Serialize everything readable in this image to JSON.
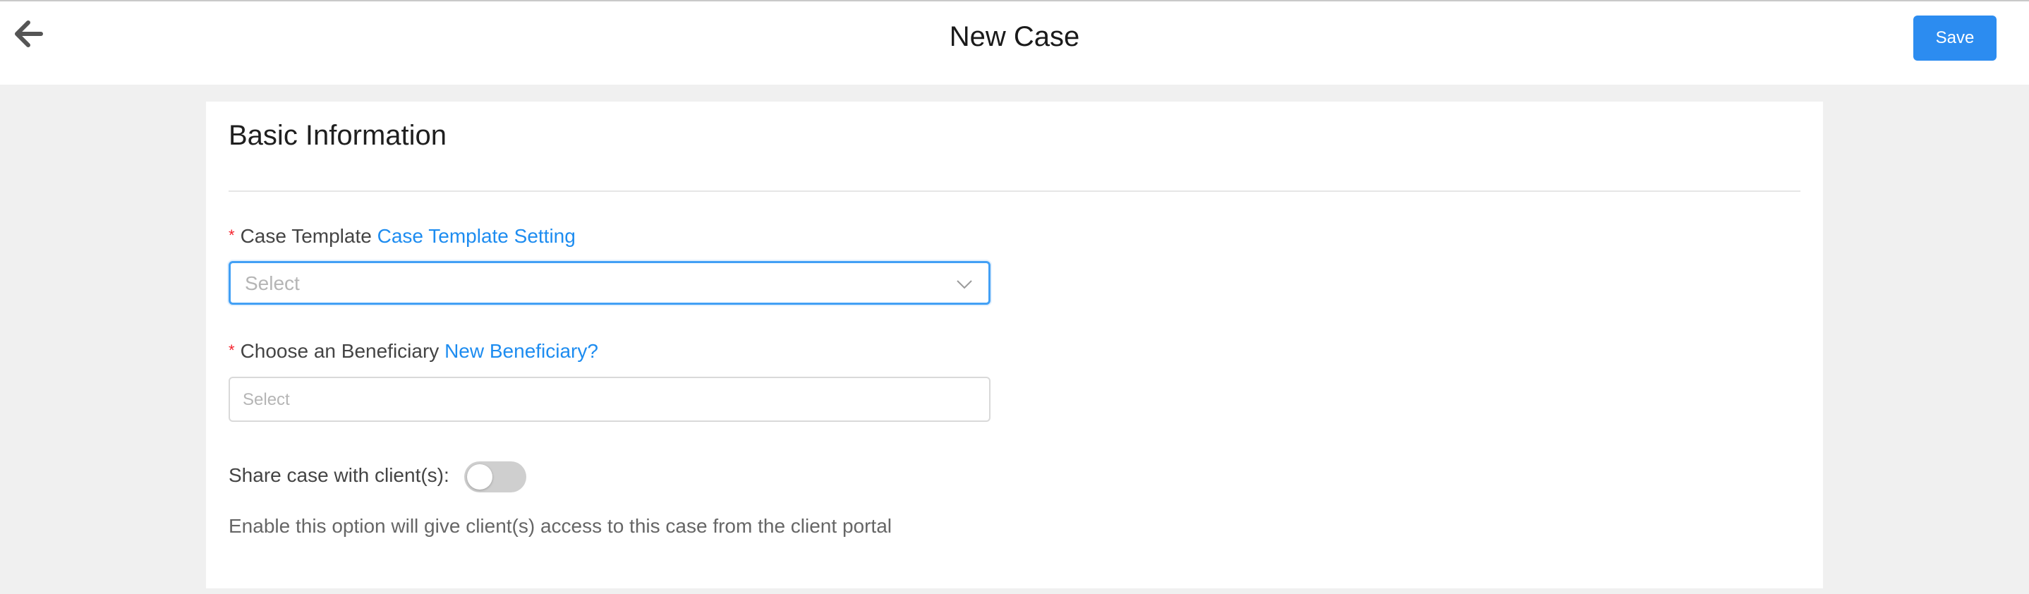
{
  "header": {
    "title": "New Case",
    "back_icon": "arrow-left-icon",
    "save_label": "Save"
  },
  "basic_info": {
    "title": "Basic Information",
    "case_template": {
      "required_mark": "*",
      "label": "Case Template",
      "link": "Case Template Setting",
      "placeholder": "Select",
      "icon": "chevron-down-icon"
    },
    "beneficiary": {
      "required_mark": "*",
      "label": "Choose an Beneficiary",
      "link": "New Beneficiary?",
      "placeholder": "Select"
    },
    "share": {
      "label": "Share case with client(s):",
      "enabled": false,
      "help": "Enable this option will give client(s) access to this case from the client portal"
    }
  },
  "colors": {
    "accent": "#2c8cf0",
    "link": "#1d8cf0",
    "required": "#f5222d",
    "page_bg": "#f0f0f0"
  }
}
